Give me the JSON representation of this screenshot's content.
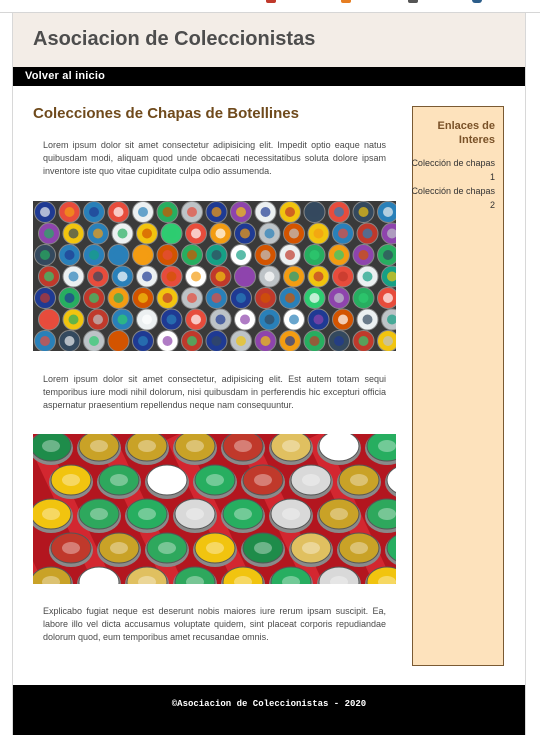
{
  "site": {
    "title": "Asociacion de Coleccionistas",
    "nav_home": "Volver al inicio"
  },
  "main": {
    "heading": "Colecciones de Chapas de Botellines",
    "paragraphs": [
      "Lorem ipsum dolor sit amet consectetur adipisicing elit. Impedit optio eaque natus quibusdam modi, aliquam quod unde obcaecati necessitatibus soluta dolore ipsam inventore iste quo vitae cupiditate culpa odio assumenda.",
      "Lorem ipsum dolor sit amet consectetur, adipisicing elit. Est autem totam sequi temporibus iure modi nihil dolorum, nisi quibusdam in perferendis hic excepturi officia aspernatur praesentium repellendus neque nam consequuntur.",
      "Explicabo fugiat neque est deserunt nobis maiores iure rerum ipsam suscipit. Ea, labore illo vel dicta accusamus voluptate quidem, sint placeat corporis repudiandae dolorum quod, eum temporibus amet recusandae omnis."
    ]
  },
  "sidebar": {
    "heading": "Enlaces de Interes",
    "links": [
      "Colección de chapas 1",
      "Colección de chapas 2"
    ]
  },
  "footer": {
    "text": "©Asociacion de Coleccionistas - 2020"
  },
  "colors": {
    "header_bg": "#f3ede7",
    "nav_bg": "#000000",
    "heading": "#6f4a1c",
    "sidebar_bg": "#fde2bc",
    "sidebar_border": "#7a5a33",
    "footer_bg": "#000000"
  },
  "images": {
    "photo1": "bottle-caps-grid-photo",
    "photo2": "bottle-caps-tray-photo"
  }
}
